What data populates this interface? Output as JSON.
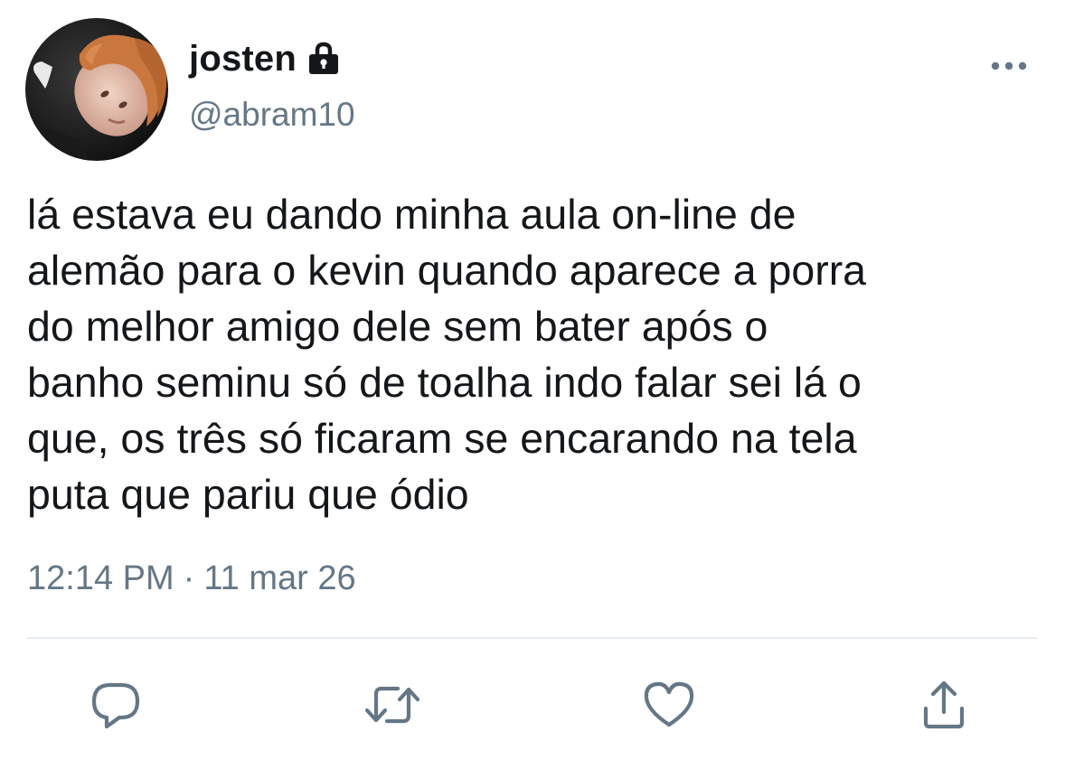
{
  "tweet": {
    "display_name": "josten",
    "handle": "@abram10",
    "protected": true,
    "text": "lá estava eu dando minha aula on-line de\nalemão para o kevin quando aparece a porra\ndo melhor amigo dele sem bater após o\nbanho seminu só de toalha indo falar sei lá o\nque, os três só ficaram se encarando na tela\nputa que pariu que ódio",
    "time": "12:14 PM",
    "separator": "·",
    "date": "11 mar 26"
  },
  "icons": {
    "protected": "lock-icon",
    "more": "more-horizontal-icon",
    "reply": "reply-icon",
    "retweet": "retweet-icon",
    "like": "heart-icon",
    "share": "share-icon"
  },
  "colors": {
    "text_primary": "#14171a",
    "text_secondary": "#657786",
    "icon": "#657786",
    "divider": "#e6ecf0"
  }
}
